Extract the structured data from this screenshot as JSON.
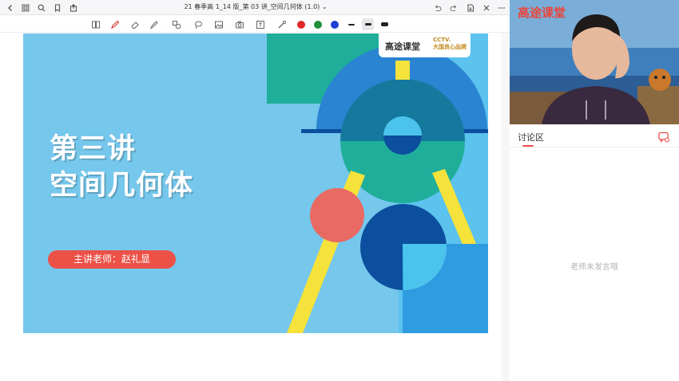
{
  "window": {
    "title": "21 春季高 1_14 版_第 03 讲_空间几何体 (1.0)",
    "title_chevron": "⌄"
  },
  "toolbar": {
    "colors": {
      "red": "#e02a2a",
      "green": "#1f8f3a",
      "blue": "#1f3fd0",
      "black": "#222222"
    }
  },
  "slide": {
    "title_line1": "第三讲",
    "title_line2": "空间几何体",
    "teacher": "主讲老师：赵礼显",
    "logo_text": "高途课堂",
    "logo_badge_line1": "CCTV.",
    "logo_badge_line2": "大国良心品牌",
    "colors": {
      "background": "#76c7ec",
      "teal": "#1fae9a",
      "blue_dark": "#1666b5",
      "navy": "#0b4f9e",
      "yellow": "#f5e23a",
      "red_circle": "#e86a63",
      "light_blue": "#4cc3ec",
      "sky": "#2f9be0"
    }
  },
  "side": {
    "video_logo": "高途课堂",
    "tab_label": "讨论区",
    "empty_message": "老师未发言哦"
  }
}
